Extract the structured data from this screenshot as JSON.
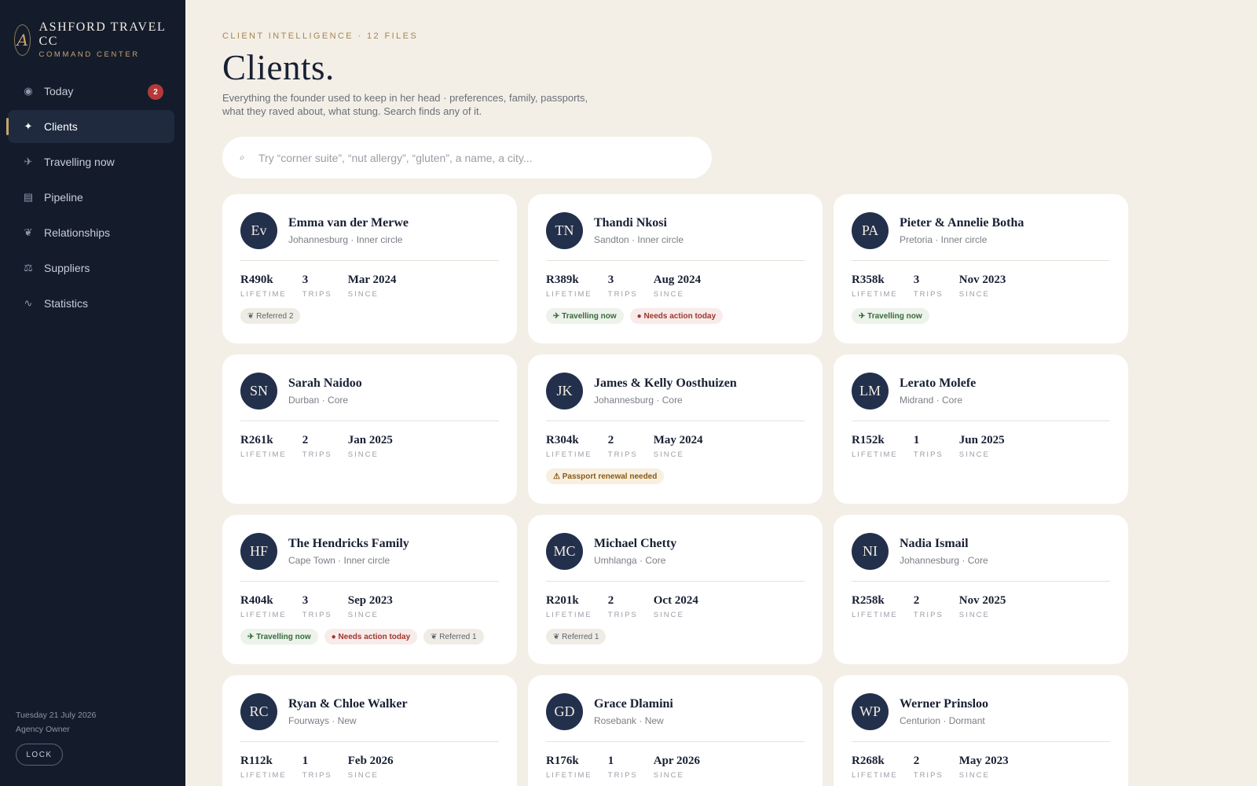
{
  "brand": {
    "name": "ASHFORD TRAVEL CC",
    "subtitle": "COMMAND CENTER",
    "logo_letter": "A"
  },
  "nav": [
    {
      "label": "Today",
      "icon": "◉",
      "icon_name": "today-icon",
      "badge": "2"
    },
    {
      "label": "Clients",
      "icon": "✦",
      "icon_name": "clients-icon",
      "active": true
    },
    {
      "label": "Travelling now",
      "icon": "✈",
      "icon_name": "plane-icon"
    },
    {
      "label": "Pipeline",
      "icon": "▤",
      "icon_name": "pipeline-icon"
    },
    {
      "label": "Relationships",
      "icon": "❦",
      "icon_name": "relationships-icon"
    },
    {
      "label": "Suppliers",
      "icon": "⚖",
      "icon_name": "suppliers-icon"
    },
    {
      "label": "Statistics",
      "icon": "∿",
      "icon_name": "statistics-icon"
    }
  ],
  "footer": {
    "date": "Tuesday 21 July 2026",
    "role": "Agency Owner",
    "lock_label": "LOCK"
  },
  "page": {
    "eyebrow": "CLIENT INTELLIGENCE · 12 FILES",
    "title": "Clients.",
    "subtitle": "Everything the founder used to keep in her head · preferences, family, passports, what they raved about, what stung. Search finds any of it."
  },
  "search": {
    "icon": "⌕",
    "placeholder": "Try “corner suite”, “nut allergy”, “gluten”, a name, a city..."
  },
  "stat_labels": {
    "lifetime": "LIFETIME",
    "trips": "TRIPS",
    "since": "SINCE"
  },
  "clients": [
    {
      "initials": "Ev",
      "name": "Emma van der Merwe",
      "meta": "Johannesburg · Inner circle",
      "lifetime": "R490k",
      "trips": "3",
      "since": "Mar 2024",
      "tags": [
        {
          "type": "referred",
          "label": "❦ Referred 2"
        }
      ]
    },
    {
      "initials": "TN",
      "name": "Thandi Nkosi",
      "meta": "Sandton · Inner circle",
      "lifetime": "R389k",
      "trips": "3",
      "since": "Aug 2024",
      "tags": [
        {
          "type": "travel",
          "label": "✈ Travelling now"
        },
        {
          "type": "action",
          "label": "● Needs action today"
        }
      ]
    },
    {
      "initials": "PA",
      "name": "Pieter & Annelie Botha",
      "meta": "Pretoria · Inner circle",
      "lifetime": "R358k",
      "trips": "3",
      "since": "Nov 2023",
      "tags": [
        {
          "type": "travel",
          "label": "✈ Travelling now"
        }
      ]
    },
    {
      "initials": "SN",
      "name": "Sarah Naidoo",
      "meta": "Durban · Core",
      "lifetime": "R261k",
      "trips": "2",
      "since": "Jan 2025",
      "tags": []
    },
    {
      "initials": "JK",
      "name": "James & Kelly Oosthuizen",
      "meta": "Johannesburg · Core",
      "lifetime": "R304k",
      "trips": "2",
      "since": "May 2024",
      "tags": [
        {
          "type": "passport",
          "label": "⚠ Passport renewal needed"
        }
      ]
    },
    {
      "initials": "LM",
      "name": "Lerato Molefe",
      "meta": "Midrand · Core",
      "lifetime": "R152k",
      "trips": "1",
      "since": "Jun 2025",
      "tags": []
    },
    {
      "initials": "HF",
      "name": "The Hendricks Family",
      "meta": "Cape Town · Inner circle",
      "lifetime": "R404k",
      "trips": "3",
      "since": "Sep 2023",
      "tags": [
        {
          "type": "travel",
          "label": "✈ Travelling now"
        },
        {
          "type": "action",
          "label": "● Needs action today"
        },
        {
          "type": "referred",
          "label": "❦ Referred 1"
        }
      ]
    },
    {
      "initials": "MC",
      "name": "Michael Chetty",
      "meta": "Umhlanga · Core",
      "lifetime": "R201k",
      "trips": "2",
      "since": "Oct 2024",
      "tags": [
        {
          "type": "referred",
          "label": "❦ Referred 1"
        }
      ]
    },
    {
      "initials": "NI",
      "name": "Nadia Ismail",
      "meta": "Johannesburg · Core",
      "lifetime": "R258k",
      "trips": "2",
      "since": "Nov 2025",
      "tags": []
    },
    {
      "initials": "RC",
      "name": "Ryan & Chloe Walker",
      "meta": "Fourways · New",
      "lifetime": "R112k",
      "trips": "1",
      "since": "Feb 2026",
      "tags": []
    },
    {
      "initials": "GD",
      "name": "Grace Dlamini",
      "meta": "Rosebank · New",
      "lifetime": "R176k",
      "trips": "1",
      "since": "Apr 2026",
      "tags": []
    },
    {
      "initials": "WP",
      "name": "Werner Prinsloo",
      "meta": "Centurion · Dormant",
      "lifetime": "R268k",
      "trips": "2",
      "since": "May 2023",
      "tags": []
    }
  ]
}
